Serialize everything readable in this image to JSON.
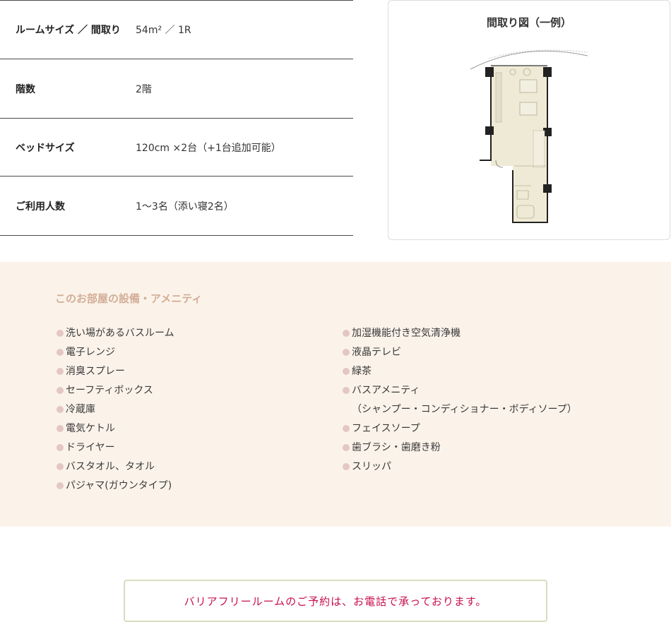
{
  "room_specs": [
    {
      "label": "ルームサイズ ／ 間取り",
      "value": "54m² ／ 1R"
    },
    {
      "label": "階数",
      "value": "2階"
    },
    {
      "label": "ベッドサイズ",
      "value": "120cm ×2台（+1台追加可能）"
    },
    {
      "label": "ご利用人数",
      "value": "1〜3名（添い寝2名）"
    }
  ],
  "floor_plan": {
    "title": "間取り図（一例）",
    "colors": {
      "floor": "#eeead5",
      "wall": "#222222"
    }
  },
  "amenities": {
    "title": "このお部屋の設備・アメニティ",
    "column1": [
      "洗い場があるバスルーム",
      "電子レンジ",
      "消臭スプレー",
      "セーフティボックス",
      "冷蔵庫",
      "電気ケトル",
      "ドライヤー",
      "バスタオル、タオル",
      "パジャマ(ガウンタイプ)"
    ],
    "column2": [
      "加湿機能付き空気清浄機",
      "液晶テレビ",
      "緑茶",
      "バスアメニティ",
      "フェイスソープ",
      "歯ブラシ・歯磨き粉",
      "スリッパ"
    ],
    "bath_amenity_note": "（シャンプー・コンディショナー・ボディソープ）",
    "colors": {
      "background": "#fbf3ea",
      "title": "#d3ad96",
      "bullet": "#e3c7c2"
    }
  },
  "reservation": {
    "text": "バリアフリールームのご予約は、お電話で承っております。",
    "colors": {
      "text": "#c8104c",
      "border": "#dadcbf"
    }
  }
}
